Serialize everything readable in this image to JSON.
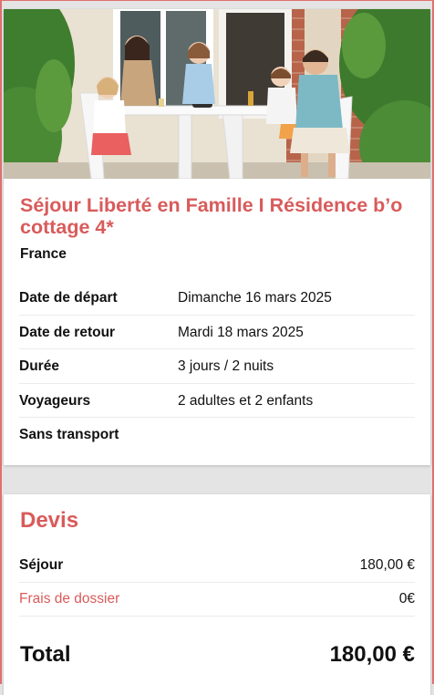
{
  "trip": {
    "photo_alt": "Family at a patio table",
    "title": "Séjour Liberté en Famille I Résidence b’o cottage 4*",
    "country": "France",
    "details": [
      {
        "label": "Date de départ",
        "value": "Dimanche 16 mars 2025"
      },
      {
        "label": "Date de retour",
        "value": "Mardi 18 mars 2025"
      },
      {
        "label": "Durée",
        "value": "3 jours / 2 nuits"
      },
      {
        "label": "Voyageurs",
        "value": "2 adultes et 2 enfants"
      },
      {
        "label": "Sans transport",
        "value": ""
      }
    ]
  },
  "quote": {
    "title": "Devis",
    "rows": [
      {
        "label": "Séjour",
        "value": "180,00 €"
      },
      {
        "label": "Frais de dossier",
        "value": "0€"
      }
    ],
    "total_label": "Total",
    "total_value": "180,00 €"
  },
  "colors": {
    "accent": "#d95b5b",
    "text": "#111111",
    "background": "#e4e4e4",
    "card": "#ffffff"
  }
}
